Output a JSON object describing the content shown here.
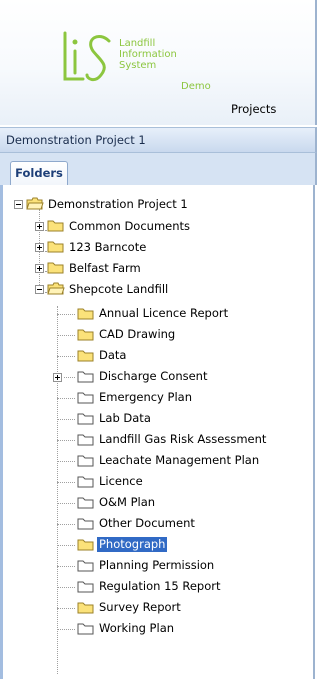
{
  "app": {
    "logo": {
      "letters": "LIS",
      "line1": "Landfill",
      "line2": "Information",
      "line3": "System",
      "badge": "Demo"
    },
    "nav_projects": "Projects",
    "current_project": "Demonstration Project 1",
    "tabs": [
      "Folders"
    ]
  },
  "tree": {
    "root": "Demonstration Project 1",
    "level1": [
      "Common Documents",
      "123 Barncote",
      "Belfast Farm",
      "Shepcote Landfill"
    ],
    "shepcote_children": [
      "Annual Licence Report",
      "CAD Drawing",
      "Data",
      "Discharge Consent",
      "Emergency Plan",
      "Lab Data",
      "Landfill Gas Risk Assessment",
      "Leachate Management Plan",
      "Licence",
      "O&M Plan",
      "Other Document",
      "Photograph",
      "Planning Permission",
      "Regulation 15 Report",
      "Survey Report",
      "Working Plan"
    ],
    "selected": "Photograph"
  },
  "colors": {
    "logo_green": "#8cc63f",
    "folder_yellow": "#fbe27a",
    "folder_white": "#ffffff",
    "selection_blue": "#316ac5",
    "panel_border": "#9db3cf"
  }
}
